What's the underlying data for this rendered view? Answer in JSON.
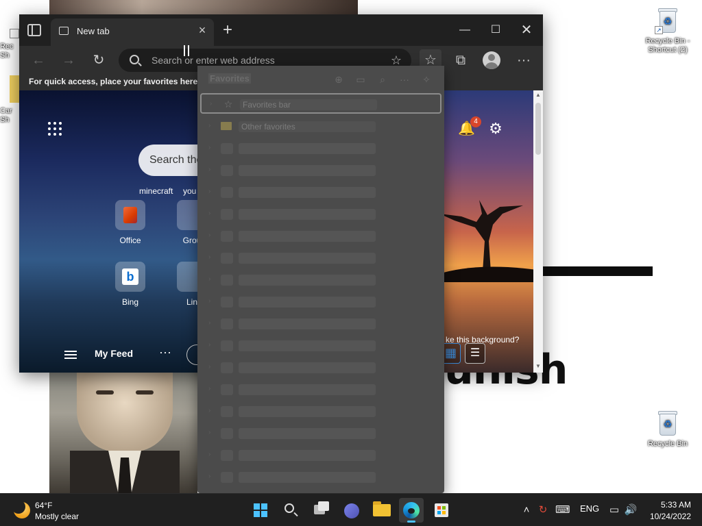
{
  "desktop": {
    "wallpaper_text": "unish",
    "icons": [
      {
        "label": "Recycle Bin - Shortcut (2)"
      },
      {
        "label": "Recycle Bin"
      }
    ],
    "left_stub_top": "Rec\nSh",
    "left_stub_bottom": "Car\nSh"
  },
  "browser": {
    "tab_title": "New tab",
    "address_placeholder": "Search or enter web address",
    "favorites_bar_text": "For quick access, place your favorites here on",
    "ntp": {
      "search_placeholder": "Search the",
      "quick_links": [
        "minecraft",
        "you"
      ],
      "tiles": [
        {
          "label": "Office"
        },
        {
          "label": "Grou"
        },
        {
          "label": "Bing"
        },
        {
          "label": "Lin"
        }
      ],
      "notification_count": "4",
      "background_question": "ke this background?",
      "feed_title": "My Feed",
      "more": "···"
    }
  },
  "favorites_flyout": {
    "title": "Favorites",
    "items": [
      {
        "label": "Favorites bar"
      },
      {
        "label": "Other favorites"
      }
    ],
    "placeholder_rows": 16
  },
  "taskbar": {
    "weather_temp": "64°F",
    "weather_desc": "Mostly clear",
    "language": "ENG",
    "time": "5:33 AM",
    "date": "10/24/2022"
  },
  "colors": {
    "accent": "#4cc2ff",
    "badge": "#d9462b",
    "flyout_bg": "#4b4b4b"
  }
}
